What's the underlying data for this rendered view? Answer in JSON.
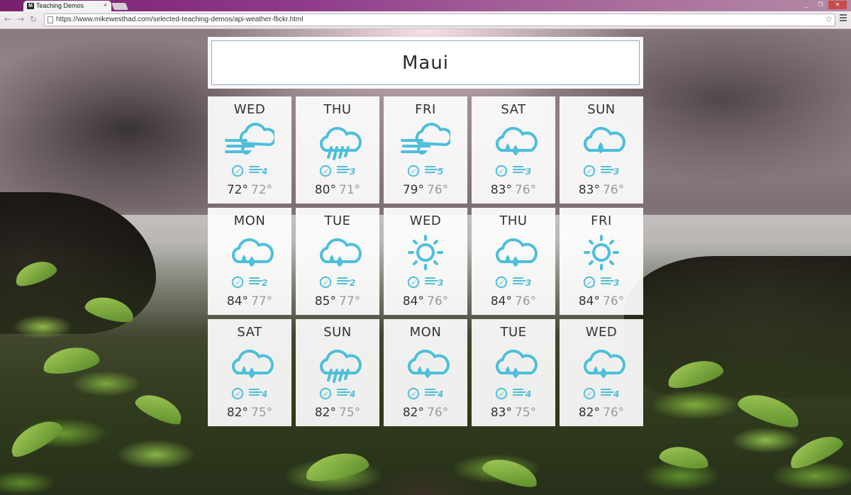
{
  "browser": {
    "tab_title": "Teaching Demos",
    "tab_favicon": "M",
    "tab_close": "×",
    "url": "https://www.mikewesthad.com/selected-teaching-demos/api-weather-flickr.html",
    "window_controls": [
      "_",
      "❐",
      "✕"
    ],
    "nav": {
      "back": "←",
      "forward": "→",
      "reload": "↻"
    },
    "star": "☆"
  },
  "search": {
    "value": "Maui"
  },
  "colors": {
    "icon": "#4cbfdb",
    "card_bg": "#ffffff"
  },
  "forecast": [
    {
      "day": "WED",
      "icon": "wind-cloud-icon",
      "wind": "4",
      "hi": "72°",
      "lo": "72°"
    },
    {
      "day": "THU",
      "icon": "heavy-rain-icon",
      "wind": "3",
      "hi": "80°",
      "lo": "71°"
    },
    {
      "day": "FRI",
      "icon": "wind-cloud-icon",
      "wind": "5",
      "hi": "79°",
      "lo": "76°"
    },
    {
      "day": "SAT",
      "icon": "rain-drops-icon",
      "wind": "3",
      "hi": "83°",
      "lo": "76°"
    },
    {
      "day": "SUN",
      "icon": "rain-drop-icon",
      "wind": "3",
      "hi": "83°",
      "lo": "76°"
    },
    {
      "day": "MON",
      "icon": "rain-drops-icon",
      "wind": "2",
      "hi": "84°",
      "lo": "77°"
    },
    {
      "day": "TUE",
      "icon": "rain-drops-icon",
      "wind": "2",
      "hi": "85°",
      "lo": "77°"
    },
    {
      "day": "WED",
      "icon": "sun-icon",
      "wind": "3",
      "hi": "84°",
      "lo": "76°"
    },
    {
      "day": "THU",
      "icon": "rain-drops-icon",
      "wind": "3",
      "hi": "84°",
      "lo": "76°"
    },
    {
      "day": "FRI",
      "icon": "sun-icon",
      "wind": "3",
      "hi": "84°",
      "lo": "76°"
    },
    {
      "day": "SAT",
      "icon": "rain-drops-icon",
      "wind": "4",
      "hi": "82°",
      "lo": "75°"
    },
    {
      "day": "SUN",
      "icon": "heavy-rain-icon",
      "wind": "4",
      "hi": "82°",
      "lo": "75°"
    },
    {
      "day": "MON",
      "icon": "rain-drops-icon",
      "wind": "4",
      "hi": "82°",
      "lo": "76°"
    },
    {
      "day": "TUE",
      "icon": "rain-drops-icon",
      "wind": "4",
      "hi": "83°",
      "lo": "75°"
    },
    {
      "day": "WED",
      "icon": "rain-drops-icon",
      "wind": "4",
      "hi": "82°",
      "lo": "76°"
    }
  ]
}
